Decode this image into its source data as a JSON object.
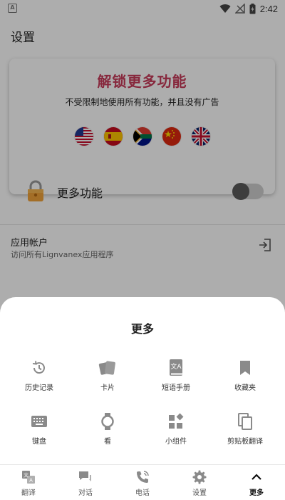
{
  "status_bar": {
    "app_icon_letter": "A",
    "time": "2:42"
  },
  "page": {
    "title": "设置",
    "promo": {
      "title": "解锁更多功能",
      "subtitle": "不受限制地使用所有功能，并且没有广告",
      "flags": [
        "us-flag-icon",
        "spain-flag-icon",
        "south-africa-flag-icon",
        "china-flag-icon",
        "uk-flag-icon"
      ],
      "feature_label": "更多功能",
      "toggle_on": false
    },
    "account": {
      "title": "应用帐户",
      "subtitle": "访问所有Lignvanex应用程序"
    }
  },
  "sheet": {
    "title": "更多",
    "items": [
      {
        "label": "历史记录",
        "icon": "history-icon"
      },
      {
        "label": "卡片",
        "icon": "cards-icon"
      },
      {
        "label": "短语手册",
        "icon": "phrasebook-icon"
      },
      {
        "label": "收藏夹",
        "icon": "bookmark-icon"
      },
      {
        "label": "键盘",
        "icon": "keyboard-icon"
      },
      {
        "label": "看",
        "icon": "watch-icon"
      },
      {
        "label": "小组件",
        "icon": "widgets-icon"
      },
      {
        "label": "剪贴板翻译",
        "icon": "clipboard-icon"
      }
    ]
  },
  "bottom_nav": {
    "items": [
      {
        "label": "翻译",
        "icon": "translate-icon"
      },
      {
        "label": "对话",
        "icon": "chat-icon"
      },
      {
        "label": "电话",
        "icon": "phone-icon"
      },
      {
        "label": "设置",
        "icon": "settings-icon"
      },
      {
        "label": "更多",
        "icon": "chevron-up-icon"
      }
    ],
    "active": "更多"
  },
  "colors": {
    "accent": "#c73b5a",
    "icon_gray": "#8a8a8a",
    "scrim": "#000000"
  }
}
